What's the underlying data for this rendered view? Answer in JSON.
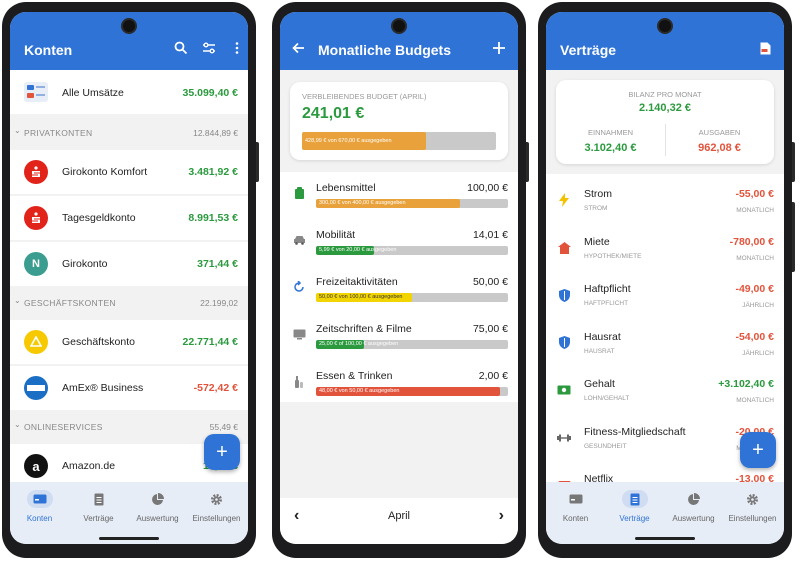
{
  "screen1": {
    "title": "Konten",
    "all": {
      "label": "Alle Umsätze",
      "amount": "35.099,40 €"
    },
    "sections": [
      {
        "label": "PRIVATKONTEN",
        "amount": "12.844,89 €"
      },
      {
        "label": "GESCHÄFTSKONTEN",
        "amount": "22.199,02"
      },
      {
        "label": "ONLINESERVICES",
        "amount": "55,49 €"
      }
    ],
    "accounts": [
      {
        "label": "Girokonto Komfort",
        "amount": "3.481,92 €"
      },
      {
        "label": "Tagesgeldkonto",
        "amount": "8.991,53 €"
      },
      {
        "label": "Girokonto",
        "amount": "371,44 €",
        "icon_text": "N"
      },
      {
        "label": "Geschäftskonto",
        "amount": "22.771,44 €"
      },
      {
        "label": "AmEx® Business",
        "amount": "-572,42 €"
      },
      {
        "label": "Amazon.de",
        "amount": "10,00 €",
        "icon_text": "a"
      }
    ],
    "fab": "+"
  },
  "nav": {
    "konten": "Konten",
    "vertraege": "Verträge",
    "auswertung": "Auswertung",
    "einstellungen": "Einstellungen"
  },
  "screen2": {
    "title": "Monatliche Budgets",
    "remaining_label": "VERBLEIBENDES BUDGET (APRIL)",
    "remaining_value": "241,01 €",
    "summary_bar": {
      "text": "428,99 € von 670,00 € ausgegeben",
      "fraction": 0.64,
      "color": "#e9a23b"
    },
    "budgets": [
      {
        "category": "Lebensmittel",
        "value": "100,00 €",
        "bar_text": "300,00 € von 400,00 € ausgegeben",
        "fraction": 0.75,
        "color": "#e9a23b"
      },
      {
        "category": "Mobilität",
        "value": "14,01 €",
        "bar_text": "5,99 € von 20,00 € ausgegeben",
        "fraction": 0.3,
        "color": "#2b9a3e"
      },
      {
        "category": "Freizeitaktivitäten",
        "value": "50,00 €",
        "bar_text": "50,00 € von 100,00 € ausgegeben",
        "fraction": 0.5,
        "color": "#f2d400"
      },
      {
        "category": "Zeitschriften & Filme",
        "value": "75,00 €",
        "bar_text": "25,00 € of 100,00 € ausgegeben",
        "fraction": 0.25,
        "color": "#2b9a3e"
      },
      {
        "category": "Essen & Trinken",
        "value": "2,00 €",
        "bar_text": "48,00 € von 50,00 € ausgegeben",
        "fraction": 0.96,
        "color": "#e2533c"
      }
    ],
    "month": "April",
    "prev": "‹",
    "next": "›"
  },
  "screen3": {
    "title": "Verträge",
    "balance_label": "BILANZ PRO MONAT",
    "balance_value": "2.140,32 €",
    "income_label": "EINNAHMEN",
    "income_value": "3.102,40 €",
    "expense_label": "AUSGABEN",
    "expense_value": "962,08 €",
    "contracts": [
      {
        "label": "Strom",
        "sub": "STROM",
        "amount": "-55,00 €",
        "freq": "MONATLICH",
        "positive": false,
        "icon": "lightning-icon"
      },
      {
        "label": "Miete",
        "sub": "HYPOTHEK/MIETE",
        "amount": "-780,00 €",
        "freq": "MONATLICH",
        "positive": false,
        "icon": "house-icon"
      },
      {
        "label": "Haftpflicht",
        "sub": "HAFTPFLICHT",
        "amount": "-49,00 €",
        "freq": "JÄHRLICH",
        "positive": false,
        "icon": "shield-icon"
      },
      {
        "label": "Hausrat",
        "sub": "HAUSRAT",
        "amount": "-54,00 €",
        "freq": "JÄHRLICH",
        "positive": false,
        "icon": "shield-icon"
      },
      {
        "label": "Gehalt",
        "sub": "LOHN/GEHALT",
        "amount": "+3.102,40 €",
        "freq": "MONATLICH",
        "positive": true,
        "icon": "money-icon"
      },
      {
        "label": "Fitness-Mitgliedschaft",
        "sub": "GESUNDHEIT",
        "amount": "-20,00 €",
        "freq": "MONATLICH",
        "positive": false,
        "icon": "dumbbell-icon"
      },
      {
        "label": "Netflix",
        "sub": "",
        "amount": "-13,00 €",
        "freq": "",
        "positive": false,
        "icon": "tv-icon"
      }
    ],
    "fab": "+"
  }
}
